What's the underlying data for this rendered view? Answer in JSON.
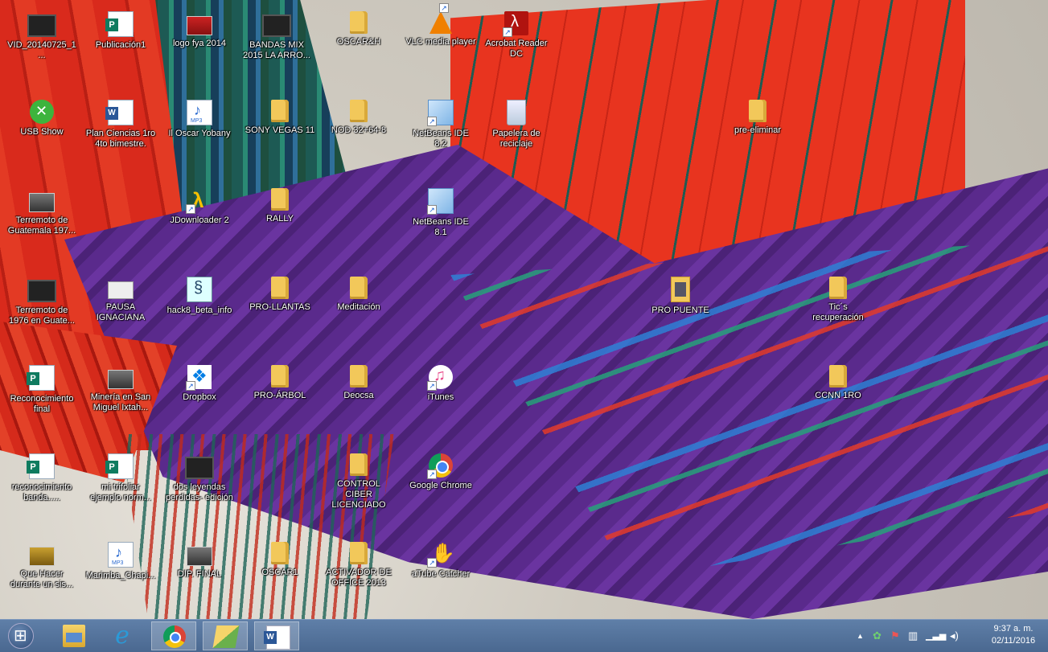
{
  "desktop": {
    "icons": [
      {
        "label": "VID_20140725_1...",
        "icon": "video-icon"
      },
      {
        "label": "Publicación1",
        "icon": "publisher-icon"
      },
      {
        "label": "logo fya 2014",
        "icon": "image-icon"
      },
      {
        "label": "BANDAS MIX 2015  LA ARRO...",
        "icon": "video-icon"
      },
      {
        "label": "OSCAR&H",
        "icon": "folder-icon"
      },
      {
        "label": "VLC media player",
        "icon": "vlc-icon"
      },
      {
        "label": "Acrobat Reader DC",
        "icon": "acrobat-icon"
      },
      {
        "label": "USB Show",
        "icon": "usb-show-icon"
      },
      {
        "label": "Plan Ciencias 1ro 4to bimestre.",
        "icon": "word-doc-icon"
      },
      {
        "label": "Il Oscar Yobany",
        "icon": "mp3-icon"
      },
      {
        "label": "SONY VEGAS 11",
        "icon": "folder-icon"
      },
      {
        "label": "NOD 32+64-8",
        "icon": "folder-icon"
      },
      {
        "label": "NetBeans IDE 8.2",
        "icon": "netbeans-icon"
      },
      {
        "label": "Papelera de reciclaje",
        "icon": "recycle-bin-icon"
      },
      {
        "label": "pre-eliminar",
        "icon": "folder-icon"
      },
      {
        "label": "Terremoto de Guatemala 197...",
        "icon": "image-icon"
      },
      {
        "label": "JDownloader 2",
        "icon": "jdownloader-icon"
      },
      {
        "label": "RALLY",
        "icon": "folder-icon"
      },
      {
        "label": "NetBeans IDE 8.1",
        "icon": "netbeans-icon"
      },
      {
        "label": "Terremoto de 1976 en Guate...",
        "icon": "video-icon"
      },
      {
        "label": "PAUSA IGNACIANA",
        "icon": "document-icon"
      },
      {
        "label": "hack8_beta_info",
        "icon": "hack-icon"
      },
      {
        "label": "PRO-LLANTAS",
        "icon": "folder-icon"
      },
      {
        "label": "Meditación",
        "icon": "folder-icon"
      },
      {
        "label": "PRO PUENTE",
        "icon": "folder-image-icon"
      },
      {
        "label": "Tic´s recuperación",
        "icon": "folder-icon"
      },
      {
        "label": "Reconocimiento final",
        "icon": "publisher-icon"
      },
      {
        "label": "Minería en San Miguel Ixtah...",
        "icon": "image-icon"
      },
      {
        "label": "Dropbox",
        "icon": "dropbox-icon"
      },
      {
        "label": "PRO-ÁRBOL",
        "icon": "folder-icon"
      },
      {
        "label": "Deocsa",
        "icon": "folder-icon"
      },
      {
        "label": "iTunes",
        "icon": "itunes-icon"
      },
      {
        "label": "CCNN 1RO",
        "icon": "folder-icon"
      },
      {
        "label": "reconocimiento banda.....",
        "icon": "publisher-icon"
      },
      {
        "label": "mi trifoliar ejemplo norm...",
        "icon": "publisher-icon"
      },
      {
        "label": "dos leyendas perdidas- edición",
        "icon": "video-icon"
      },
      {
        "label": "CONTROL CIBER LICENCIADO",
        "icon": "folder-icon"
      },
      {
        "label": "Google Chrome",
        "icon": "chrome-icon"
      },
      {
        "label": "Que Hacer durante un sis...",
        "icon": "video-icon"
      },
      {
        "label": "Marimba_Chapi...",
        "icon": "mp3-icon"
      },
      {
        "label": "DIP. FINAL",
        "icon": "image-icon"
      },
      {
        "label": "OSCAR1",
        "icon": "folder-icon"
      },
      {
        "label": "ACTIVADOR DE OFFICE 2013",
        "icon": "folder-icon"
      },
      {
        "label": "aTube Catcher",
        "icon": "atube-catcher-icon"
      }
    ]
  },
  "taskbar": {
    "start": {
      "icon": "windows-start-icon"
    },
    "pinned": [
      {
        "name": "file-explorer",
        "icon": "file-explorer-icon"
      },
      {
        "name": "internet-explorer",
        "icon": "internet-explorer-icon"
      },
      {
        "name": "google-chrome",
        "icon": "chrome-icon"
      },
      {
        "name": "folders",
        "icon": "folders-icon"
      },
      {
        "name": "microsoft-word",
        "icon": "word-icon"
      }
    ],
    "tray": {
      "show_hidden_glyph": "▲",
      "time": "9:37 a. m.",
      "date": "02/11/2016"
    }
  }
}
